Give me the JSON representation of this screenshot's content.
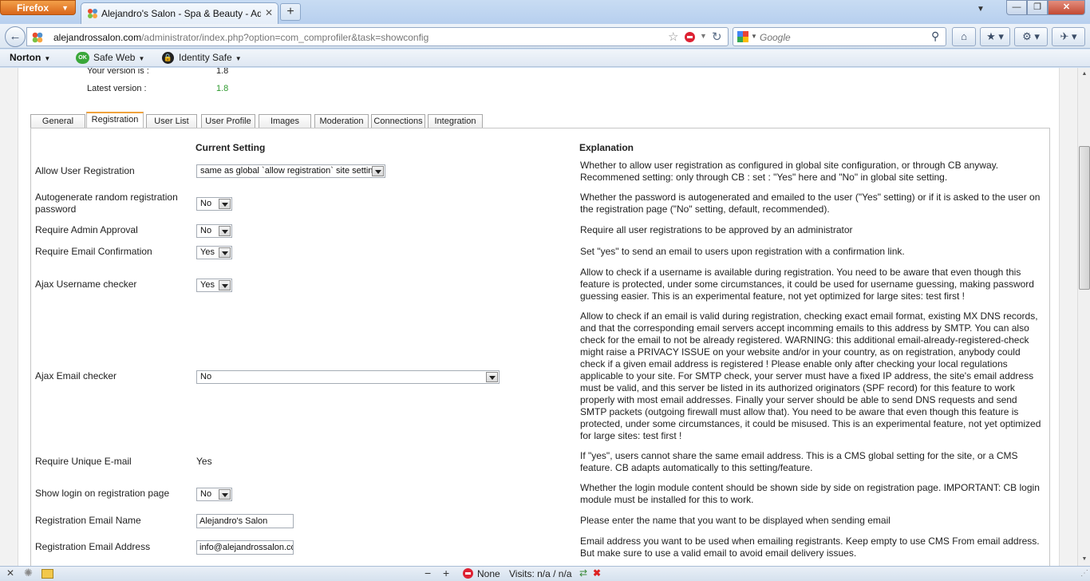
{
  "browser": {
    "menu_button": "Firefox",
    "tab_title": "Alejandro's Salon - Spa & Beauty - Admi...",
    "url_host": "alejandrossalon.com",
    "url_path": "/administrator/index.php?option=com_comprofiler&task=showconfig",
    "search_placeholder": "Google"
  },
  "norton": {
    "brand": "Norton",
    "safe_web": "Safe Web",
    "safe_web_badge": "OK",
    "identity_safe": "Identity Safe"
  },
  "version": {
    "your_label": "Your version is :",
    "your_value": "1.8",
    "latest_label": "Latest version :",
    "latest_value": "1.8",
    "latest_color": "#2e9a2e"
  },
  "tabs": [
    "General",
    "Registration",
    "User List",
    "User Profile",
    "Images",
    "Moderation",
    "Connections",
    "Integration"
  ],
  "active_tab": "Registration",
  "headers": {
    "current": "Current Setting",
    "explanation": "Explanation"
  },
  "rows": [
    {
      "label": "Allow User Registration",
      "value": "same as global `allow registration` site setting",
      "explanation": "Whether to allow user registration as configured in global site configuration, or through CB anyway. Recommened setting: only through CB : set : \"Yes\" here and \"No\" in global site setting."
    },
    {
      "label": "Autogenerate random registration password",
      "value": "No",
      "explanation": "Whether the password is autogenerated and emailed to the user (\"Yes\" setting) or if it is asked to the user on the registration page (\"No\" setting, default, recommended)."
    },
    {
      "label": "Require Admin Approval",
      "value": "No",
      "explanation": "Require all user registrations to be approved by an administrator"
    },
    {
      "label": "Require Email Confirmation",
      "value": "Yes",
      "explanation": "Set \"yes\" to send an email to users upon registration with a confirmation link."
    },
    {
      "label": "Ajax Username checker",
      "value": "Yes",
      "explanation": "Allow to check if a username is available during registration. You need to be aware that even though this feature is protected, under some circumstances, it could be used for username guessing, making password guessing easier. This is an experimental feature, not yet optimized for large sites: test first !"
    },
    {
      "label": "Ajax Email checker",
      "value": "No",
      "explanation": "Allow to check if an email is valid during registration, checking exact email format, existing MX DNS records, and that the corresponding email servers accept incomming emails to this address by SMTP. You can also check for the email to not be already registered. WARNING: this additional email-already-registered-check might raise a PRIVACY ISSUE on your website and/or in your country, as on registration, anybody could check if a given email address is registered ! Please enable only after checking your local regulations applicable to your site. For SMTP check, your server must have a fixed IP address, the site's email address must be valid, and this server be listed in its authorized originators (SPF record) for this feature to work properly with most email addresses. Finally your server should be able to send DNS requests and send SMTP packets (outgoing firewall must allow that). You need to be aware that even though this feature is protected, under some circumstances, it could be misused. This is an experimental feature, not yet optimized for large sites: test first !"
    },
    {
      "label": "Require Unique E-mail",
      "value": "Yes",
      "explanation": "If \"yes\", users cannot share the same email address. This is a CMS global setting for the site, or a CMS feature. CB adapts automatically to this setting/feature."
    },
    {
      "label": "Show login on registration page",
      "value": "No",
      "explanation": "Whether the login module content should be shown side by side on registration page. IMPORTANT: CB login module must be installed for this to work."
    },
    {
      "label": "Registration Email Name",
      "value": "Alejandro's Salon",
      "explanation": "Please enter the name that you want to be displayed when sending email"
    },
    {
      "label": "Registration Email Address",
      "value": "info@alejandrossalon.cor",
      "explanation": "Email address you want to be used when emailing registrants. Keep empty to use CMS From email address. But make sure to use a valid email to avoid email delivery issues."
    }
  ],
  "statusbar": {
    "script_status": "None",
    "visits": "Visits: n/a / n/a"
  }
}
